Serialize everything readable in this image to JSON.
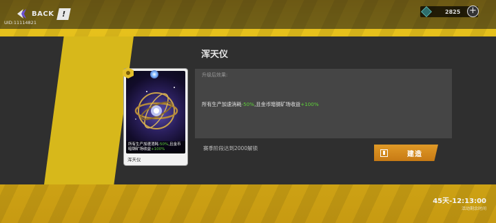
{
  "topbar": {
    "back_label": "BACK",
    "help_glyph": "!",
    "uid": "UID:11114821",
    "currency_value": "2825",
    "currency_icon": "crystal-icon",
    "plus_glyph": "+"
  },
  "card": {
    "name": "浑天仪",
    "desc_prefix": "所有生产加速消耗",
    "desc_value1": "-50%",
    "desc_mid": ",且金币暗钢矿场收益",
    "desc_value2": "+100%"
  },
  "panel": {
    "title": "浑天仪",
    "effect_label": "升级后效果:",
    "effect_prefix": "所有生产加速消耗",
    "effect_value1": "-50%",
    "effect_mid": ",且金币暗钢矿场收益",
    "effect_value2": "+100%",
    "requirement": "赛季阶段达到2000解锁",
    "build_label": "建造"
  },
  "footer": {
    "timer": "45天-12:13:00",
    "timer_sub": "活动剩余时间"
  },
  "colors": {
    "accent_orange": "#d88a1e",
    "accent_yellow": "#d7b81b",
    "positive_green": "#5fd23a"
  }
}
